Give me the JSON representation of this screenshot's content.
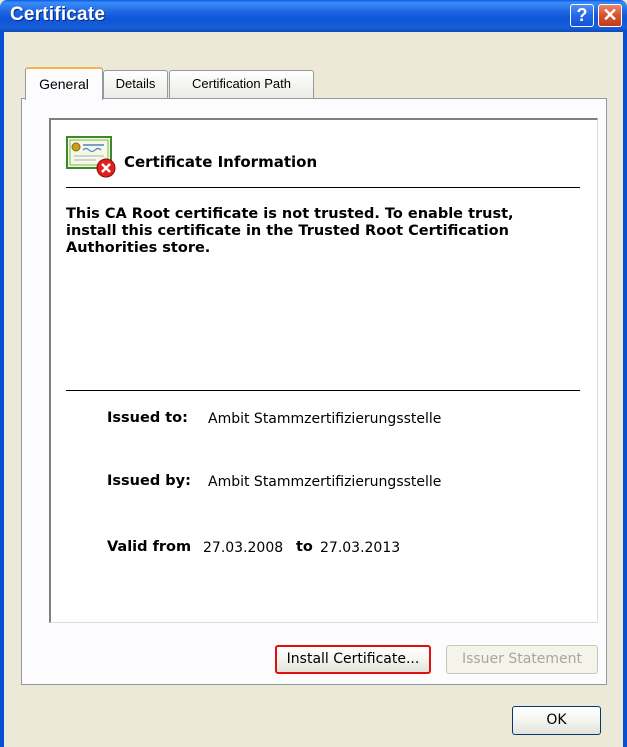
{
  "window": {
    "title": "Certificate",
    "help_label": "?",
    "close_label": "✕"
  },
  "tabs": [
    {
      "label": "General",
      "active": true
    },
    {
      "label": "Details",
      "active": false
    },
    {
      "label": "Certification Path",
      "active": false
    }
  ],
  "general": {
    "heading": "Certificate Information",
    "message": "This CA Root certificate is not trusted. To enable trust, install this certificate in the Trusted Root Certification Authorities store.",
    "issued_to_label": "Issued to:",
    "issued_to_value": "Ambit Stammzertifizierungsstelle",
    "issued_by_label": "Issued by:",
    "issued_by_value": "Ambit Stammzertifizierungsstelle",
    "valid_from_label": "Valid from",
    "valid_from_value": "27.03.2008",
    "valid_to_label": "to",
    "valid_to_value": "27.03.2013"
  },
  "buttons": {
    "install": "Install Certificate...",
    "issuer": "Issuer Statement",
    "ok": "OK"
  },
  "icons": {
    "certificate": "certificate-icon",
    "error": "error-x-icon"
  },
  "colors": {
    "titlebar": "#0d55d8",
    "highlight": "#e01010",
    "active_tab_accent": "#f7b64b"
  }
}
